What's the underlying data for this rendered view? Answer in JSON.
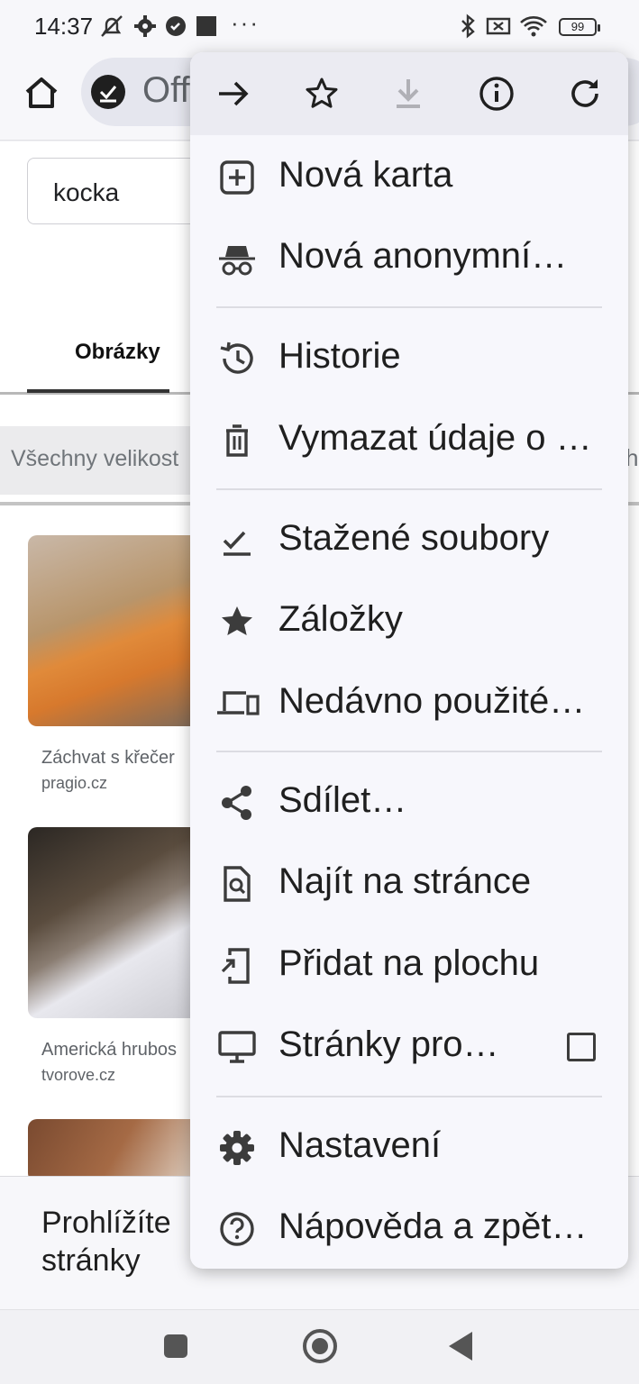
{
  "status_bar": {
    "time": "14:37",
    "left_icons": [
      "mute-icon",
      "gear-icon",
      "check-circle-icon",
      "square-icon"
    ],
    "more": "···",
    "right_icons": [
      "bluetooth-icon",
      "no-sim-icon",
      "wifi-icon"
    ],
    "battery": "99"
  },
  "toolbar": {
    "omnibox_text": "Off"
  },
  "page": {
    "search_value": "kocka",
    "tab_label": "Obrázky",
    "chip_label": "Všechny velikost",
    "chip_right_fragment": "h",
    "results": [
      {
        "caption": "Záchvat s křečer",
        "source": "pragio.cz"
      },
      {
        "caption": "Americká hrubos",
        "source": "tvorove.cz"
      }
    ]
  },
  "banner": {
    "text": "Prohlížíte stránky"
  },
  "menu": {
    "top_buttons": [
      "forward-icon",
      "bookmark-star-icon",
      "download-icon",
      "info-icon",
      "reload-icon"
    ],
    "items": [
      {
        "label": "Nová karta",
        "icon": "new-tab-icon"
      },
      {
        "label": "Nová anonymní…",
        "icon": "incognito-icon"
      },
      {
        "label": "Historie",
        "icon": "history-icon"
      },
      {
        "label": "Vymazat údaje o …",
        "icon": "trash-icon"
      },
      {
        "label": "Stažené soubory",
        "icon": "downloads-icon"
      },
      {
        "label": "Záložky",
        "icon": "star-icon"
      },
      {
        "label": "Nedávno použité…",
        "icon": "devices-icon"
      },
      {
        "label": "Sdílet…",
        "icon": "share-icon"
      },
      {
        "label": "Najít na stránce",
        "icon": "find-in-page-icon"
      },
      {
        "label": "Přidat na plochu",
        "icon": "add-to-home-icon"
      },
      {
        "label": "Stránky pro…",
        "icon": "desktop-icon"
      },
      {
        "label": "Nastavení",
        "icon": "settings-icon"
      },
      {
        "label": "Nápověda a zpět…",
        "icon": "help-icon"
      }
    ]
  }
}
